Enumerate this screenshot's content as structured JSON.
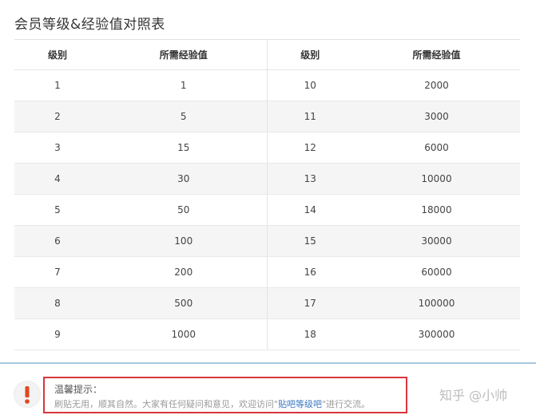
{
  "page": {
    "title": "会员等级&经验值对照表"
  },
  "table": {
    "headers": [
      "级别",
      "所需经验值",
      "级别",
      "所需经验值"
    ],
    "rows": [
      [
        "1",
        "1",
        "10",
        "2000"
      ],
      [
        "2",
        "5",
        "11",
        "3000"
      ],
      [
        "3",
        "15",
        "12",
        "6000"
      ],
      [
        "4",
        "30",
        "13",
        "10000"
      ],
      [
        "5",
        "50",
        "14",
        "18000"
      ],
      [
        "6",
        "100",
        "15",
        "30000"
      ],
      [
        "7",
        "200",
        "16",
        "60000"
      ],
      [
        "8",
        "500",
        "17",
        "100000"
      ],
      [
        "9",
        "1000",
        "18",
        "300000"
      ]
    ]
  },
  "notice": {
    "icon": "exclamation-icon",
    "title": "温馨提示：",
    "text_before": "刷贴无用，顺其自然。大家有任何疑问和意见，欢迎访问\"",
    "link_text": "贴吧等级吧",
    "text_after": "\"进行交流。"
  },
  "watermark": {
    "text": "知乎 @小帅"
  },
  "colors": {
    "accent_rule": "#a9c8de",
    "highlight_border": "#d9363e",
    "link": "#3a78c2",
    "icon": "#e2471f"
  }
}
